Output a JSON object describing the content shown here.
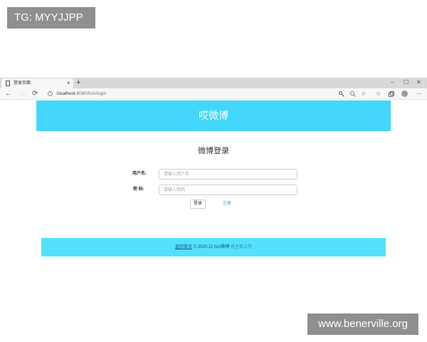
{
  "overlay": {
    "top_tag": "TG: MYYJJPP",
    "bottom_tag": "www.benerville.org"
  },
  "browser": {
    "tab_title": "登录页面",
    "tab_close": "×",
    "new_tab": "+",
    "window_controls": {
      "minimize": "–",
      "maximize": "☐",
      "close": "✕"
    },
    "url_host": "localhost",
    "url_rest": ":8080/hcz/login",
    "nav": {
      "back": "←",
      "forward": "→",
      "reload": "⟳"
    },
    "toolbar_icons": [
      "key-icon",
      "zoom-icon",
      "star-icon",
      "favorites-icon",
      "collections-icon",
      "profile-icon",
      "more-icon"
    ]
  },
  "page": {
    "header_title": "哎微博",
    "login_title": "微博登录",
    "form": {
      "username_label": "用户名:",
      "username_placeholder": "请输入用户名",
      "password_label": "密 码:",
      "password_placeholder": "请输入密码",
      "login_button": "登录",
      "register_link": "注册"
    },
    "footer": {
      "home_link": "返回首页",
      "copyright": " © 2020-11 hcz微博 ",
      "upload_link": "有主机上传"
    }
  },
  "colors": {
    "header_bg": "#43d7fb",
    "footer_bg": "#55e1fe",
    "link": "#2aa7c9"
  }
}
